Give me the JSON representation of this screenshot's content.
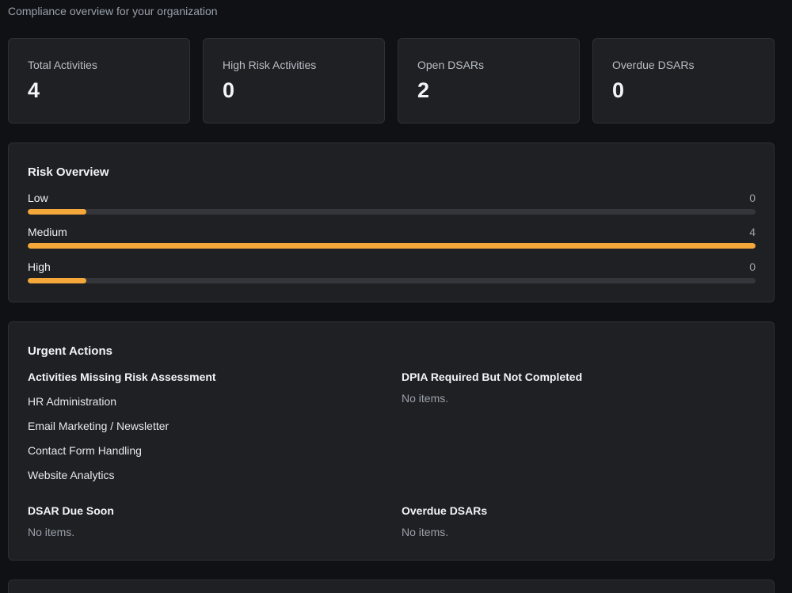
{
  "header": {
    "subtitle": "Compliance overview for your organization"
  },
  "stats": [
    {
      "label": "Total Activities",
      "value": "4"
    },
    {
      "label": "High Risk Activities",
      "value": "0"
    },
    {
      "label": "Open DSARs",
      "value": "2"
    },
    {
      "label": "Overdue DSARs",
      "value": "0"
    }
  ],
  "risk_overview": {
    "title": "Risk Overview",
    "accent_color": "#f5a83a",
    "rows": [
      {
        "label": "Low",
        "count": "0",
        "fill_fraction": 0.08
      },
      {
        "label": "Medium",
        "count": "4",
        "fill_fraction": 1.0
      },
      {
        "label": "High",
        "count": "0",
        "fill_fraction": 0.08
      }
    ]
  },
  "urgent_actions": {
    "title": "Urgent Actions",
    "missing_risk": {
      "heading": "Activities Missing Risk Assessment",
      "items": [
        "HR Administration",
        "Email Marketing / Newsletter",
        "Contact Form Handling",
        "Website Analytics"
      ]
    },
    "dpia": {
      "heading": "DPIA Required But Not Completed",
      "empty": "No items."
    },
    "dsar_due_soon": {
      "heading": "DSAR Due Soon",
      "empty": "No items."
    },
    "overdue_dsars": {
      "heading": "Overdue DSARs",
      "empty": "No items."
    }
  }
}
